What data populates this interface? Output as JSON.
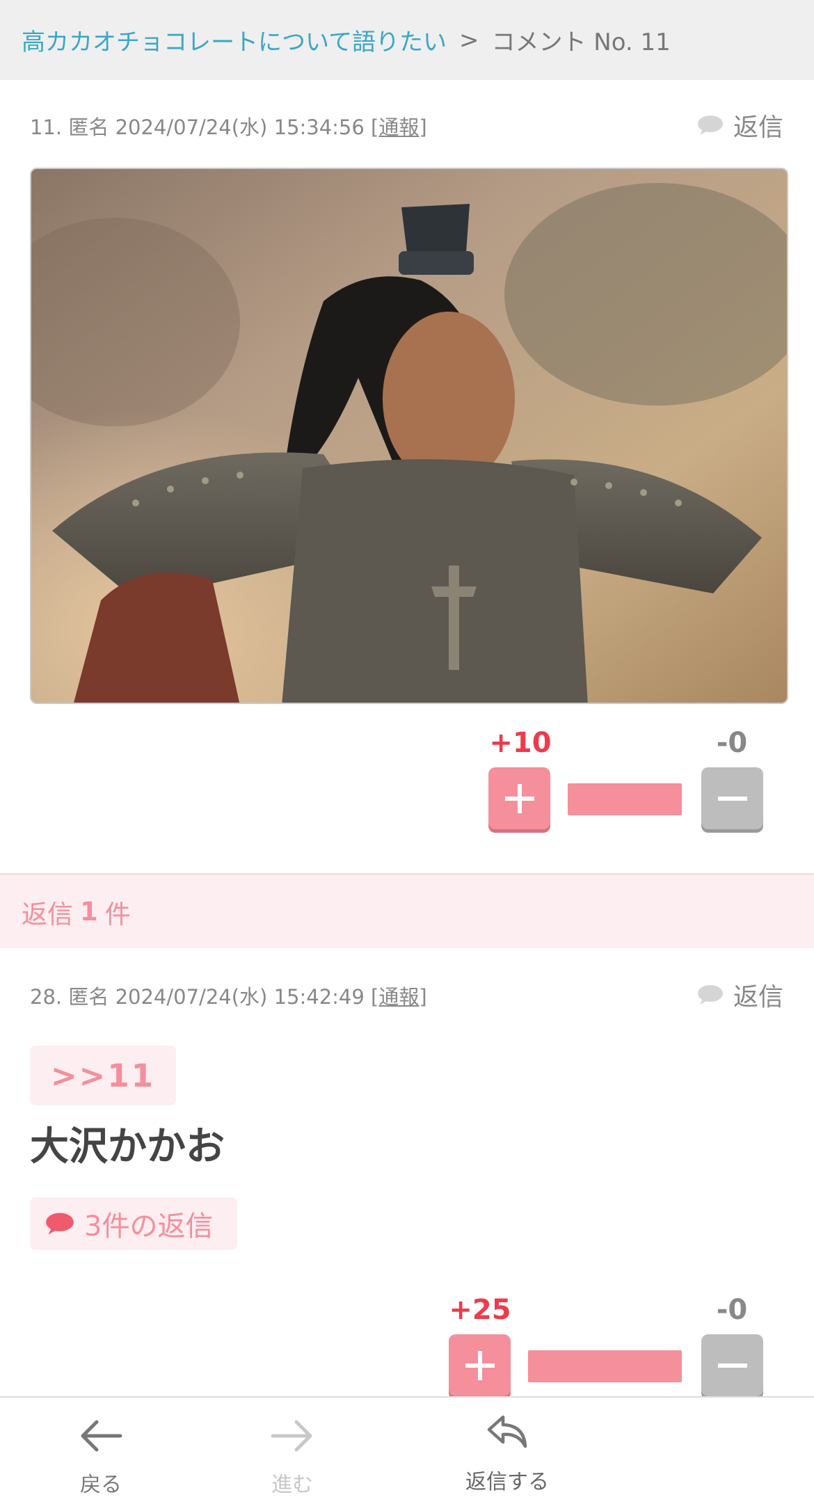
{
  "breadcrumb": {
    "topic_title": "高カカオチョコレートについて語りたい",
    "separator": ">",
    "current": "コメント No. 11"
  },
  "comment_main": {
    "number": "11.",
    "author": "匿名",
    "datetime": "2024/07/24(水) 15:34:56",
    "report_label": "通報",
    "reply_label": "返信",
    "image_description": "photo",
    "plus_votes": "+10",
    "minus_votes": "-0",
    "plus_share": 1.0
  },
  "reply_count": {
    "prefix": "返信",
    "count": "1",
    "suffix": "件"
  },
  "comment_reply": {
    "number": "28.",
    "author": "匿名",
    "datetime": "2024/07/24(水) 15:42:49",
    "report_label": "通報",
    "reply_label": "返信",
    "anchor": ">>11",
    "body": "大沢かかお",
    "replies_badge": "3件の返信",
    "plus_votes": "+25",
    "minus_votes": "-0",
    "plus_share": 1.0
  },
  "bottom_nav": {
    "back_label": "戻る",
    "forward_label": "進む",
    "reply_label": "返信する"
  },
  "colors": {
    "link": "#3aa7c7",
    "accent_pink": "#f48f9b",
    "plus_red": "#ee3a4b",
    "pink_bg": "#fdeef1",
    "minus_gray": "#bdbdbd"
  }
}
